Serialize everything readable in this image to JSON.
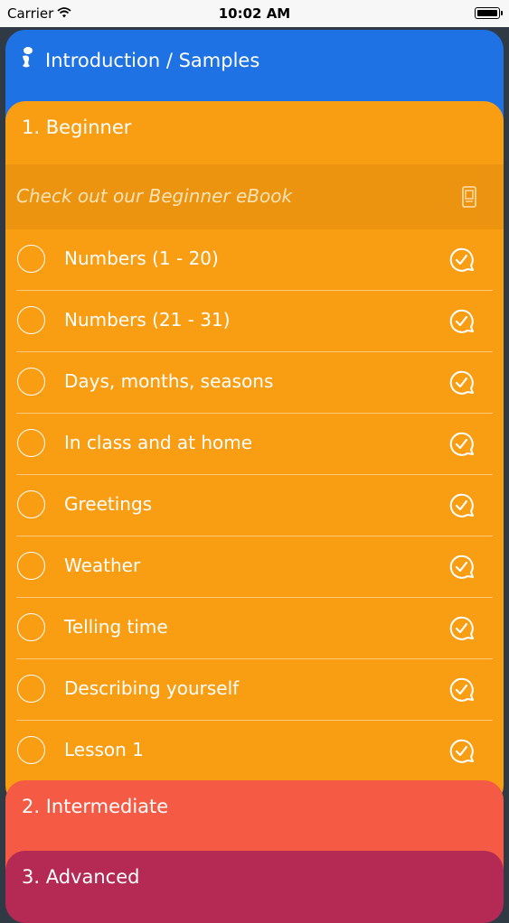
{
  "status_bar": {
    "carrier": "Carrier",
    "time": "10:02 AM"
  },
  "colors": {
    "intro": "#1f72e3",
    "beginner": "#f99d12",
    "intermediate": "#f55a45",
    "advanced": "#b52a54"
  },
  "sections": {
    "intro": {
      "title": "Introduction / Samples",
      "icon": "footprint-icon"
    },
    "beginner": {
      "title": "1. Beginner",
      "ebook_label": "Check out our Beginner eBook",
      "ebook_icon": "ebook-icon",
      "lessons": [
        {
          "label": "Numbers (1 - 20)"
        },
        {
          "label": "Numbers (21 - 31)"
        },
        {
          "label": "Days, months, seasons"
        },
        {
          "label": "In class and at home"
        },
        {
          "label": "Greetings"
        },
        {
          "label": "Weather"
        },
        {
          "label": "Telling time"
        },
        {
          "label": "Describing yourself"
        },
        {
          "label": "Lesson 1"
        }
      ]
    },
    "intermediate": {
      "title": "2. Intermediate"
    },
    "advanced": {
      "title": "3. Advanced"
    }
  }
}
